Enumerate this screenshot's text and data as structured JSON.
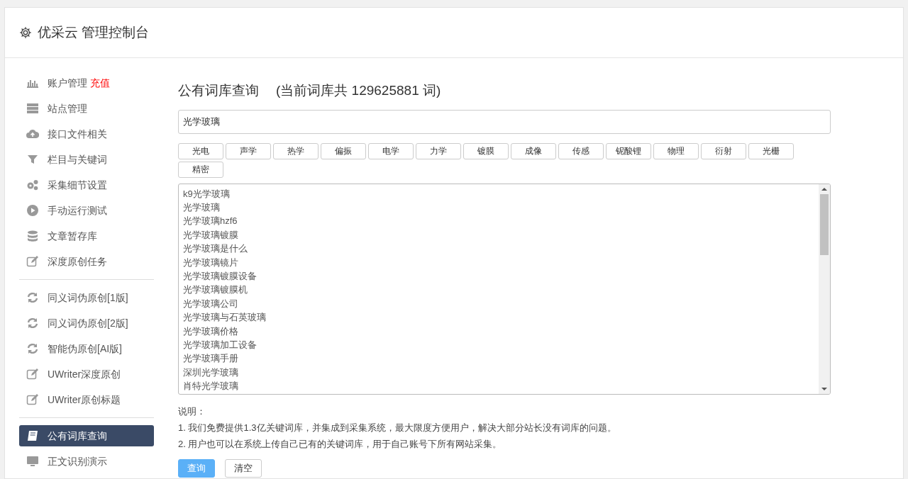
{
  "header": {
    "title": "优采云 管理控制台"
  },
  "sidebar": {
    "groups": [
      {
        "items": [
          {
            "kind": "chart",
            "label": "账户管理",
            "badge": "充值",
            "selected": false
          },
          {
            "kind": "server",
            "label": "站点管理",
            "selected": false
          },
          {
            "kind": "cloud",
            "label": "接口文件相关",
            "selected": false
          },
          {
            "kind": "filter",
            "label": "栏目与关键词",
            "selected": false
          },
          {
            "kind": "gears",
            "label": "采集细节设置",
            "selected": false
          },
          {
            "kind": "play",
            "label": "手动运行测试",
            "selected": false
          },
          {
            "kind": "database",
            "label": "文章暂存库",
            "selected": false
          },
          {
            "kind": "edit",
            "label": "深度原创任务",
            "selected": false
          }
        ]
      },
      {
        "items": [
          {
            "kind": "refresh",
            "label": "同义词伪原创[1版]",
            "selected": false
          },
          {
            "kind": "refresh",
            "label": "同义词伪原创[2版]",
            "selected": false
          },
          {
            "kind": "refresh",
            "label": "智能伪原创[AI版]",
            "selected": false
          },
          {
            "kind": "edit",
            "label": "UWriter深度原创",
            "selected": false
          },
          {
            "kind": "edit",
            "label": "UWriter原创标题",
            "selected": false
          }
        ]
      },
      {
        "items": [
          {
            "kind": "book",
            "label": "公有词库查询",
            "selected": true
          },
          {
            "kind": "monitor",
            "label": "正文识别演示",
            "selected": false
          }
        ]
      }
    ]
  },
  "main": {
    "title": "公有词库查询",
    "subtitle": "(当前词库共 129625881 词)",
    "search": {
      "value": "光学玻璃"
    },
    "tags": [
      "光电",
      "声学",
      "热学",
      "偏振",
      "电学",
      "力学",
      "镀膜",
      "成像",
      "传感",
      "铌酸锂",
      "物理",
      "衍射",
      "光栅",
      "精密"
    ],
    "results": [
      "k9光学玻璃",
      "光学玻璃",
      "光学玻璃hzf6",
      "光学玻璃镀膜",
      "光学玻璃是什么",
      "光学玻璃镜片",
      "光学玻璃镀膜设备",
      "光学玻璃镀膜机",
      "光学玻璃公司",
      "光学玻璃与石英玻璃",
      "光学玻璃价格",
      "光学玻璃加工设备",
      "光学玻璃手册",
      "深圳光学玻璃",
      "肖特光学玻璃"
    ],
    "notes_title": "说明：",
    "notes": [
      "1. 我们免费提供1.3亿关键词库，并集成到采集系统，最大限度方便用户，解决大部分站长没有词库的问题。",
      "2. 用户也可以在系统上传自己已有的关键词库，用于自己账号下所有网站采集。"
    ],
    "buttons": [
      {
        "label": "查询",
        "kind": "primary"
      },
      {
        "label": "清空",
        "kind": "default"
      }
    ]
  }
}
